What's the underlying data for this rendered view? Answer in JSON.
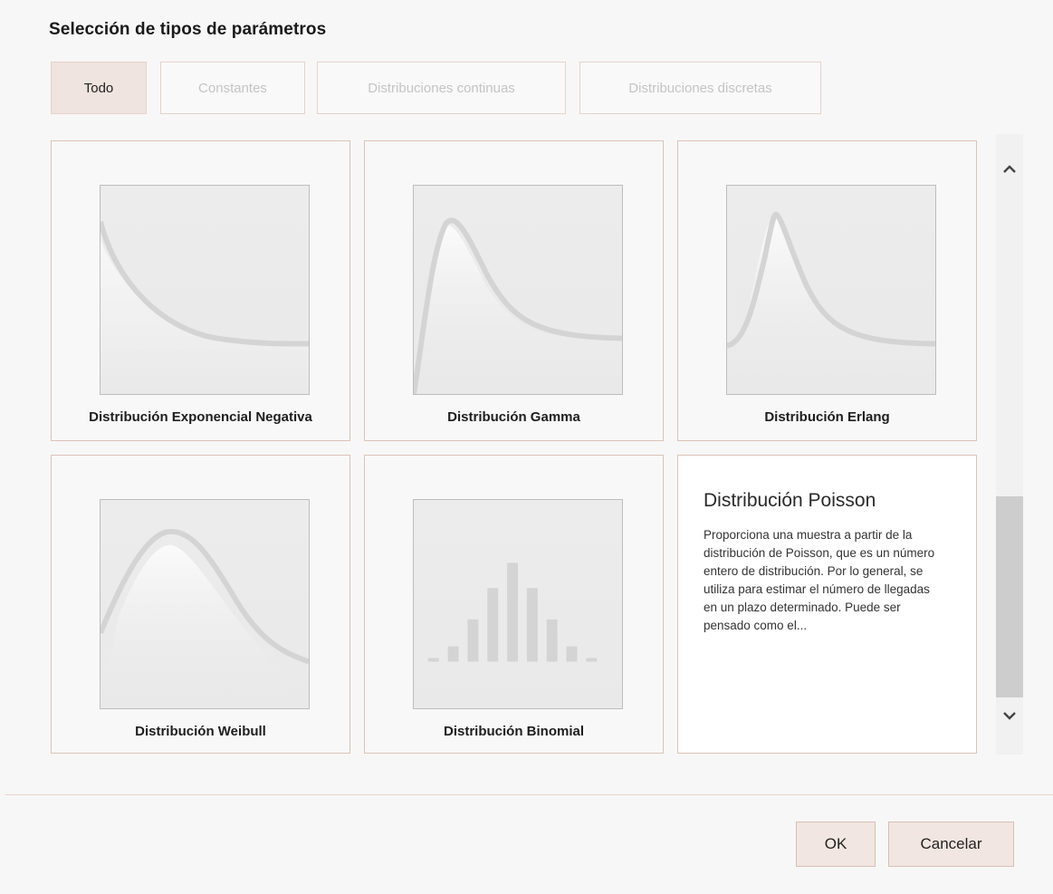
{
  "dialog": {
    "title": "Selección de tipos de parámetros"
  },
  "tabs": [
    {
      "label": "Todo",
      "active": true
    },
    {
      "label": "Constantes",
      "active": false
    },
    {
      "label": "Distribuciones continuas",
      "active": false
    },
    {
      "label": "Distribuciones discretas",
      "active": false
    }
  ],
  "cards": [
    {
      "label": "Distribución Exponencial Negativa",
      "icon": "negative-exponential-curve-icon"
    },
    {
      "label": "Distribución Gamma",
      "icon": "gamma-curve-icon"
    },
    {
      "label": "Distribución Erlang",
      "icon": "erlang-curve-icon"
    },
    {
      "label": "Distribución Weibull",
      "icon": "weibull-curve-icon"
    },
    {
      "label": "Distribución Binomial",
      "icon": "binomial-bars-icon"
    }
  ],
  "detail": {
    "title": "Distribución Poisson",
    "description": "Proporciona una muestra a partir de la distribución de Poisson, que es un número entero de distribución. Por lo general, se utiliza para estimar el número de llegadas en un plazo determinado. Puede ser pensado como el..."
  },
  "scrollbar": {
    "up_icon": "chevron-up-icon",
    "down_icon": "chevron-down-icon"
  },
  "buttons": {
    "ok_label": "OK",
    "cancel_label": "Cancelar"
  },
  "colors": {
    "active_tab": "#efe4df",
    "border_accent": "#dcc3b8",
    "curve": "#d2d2d2"
  }
}
